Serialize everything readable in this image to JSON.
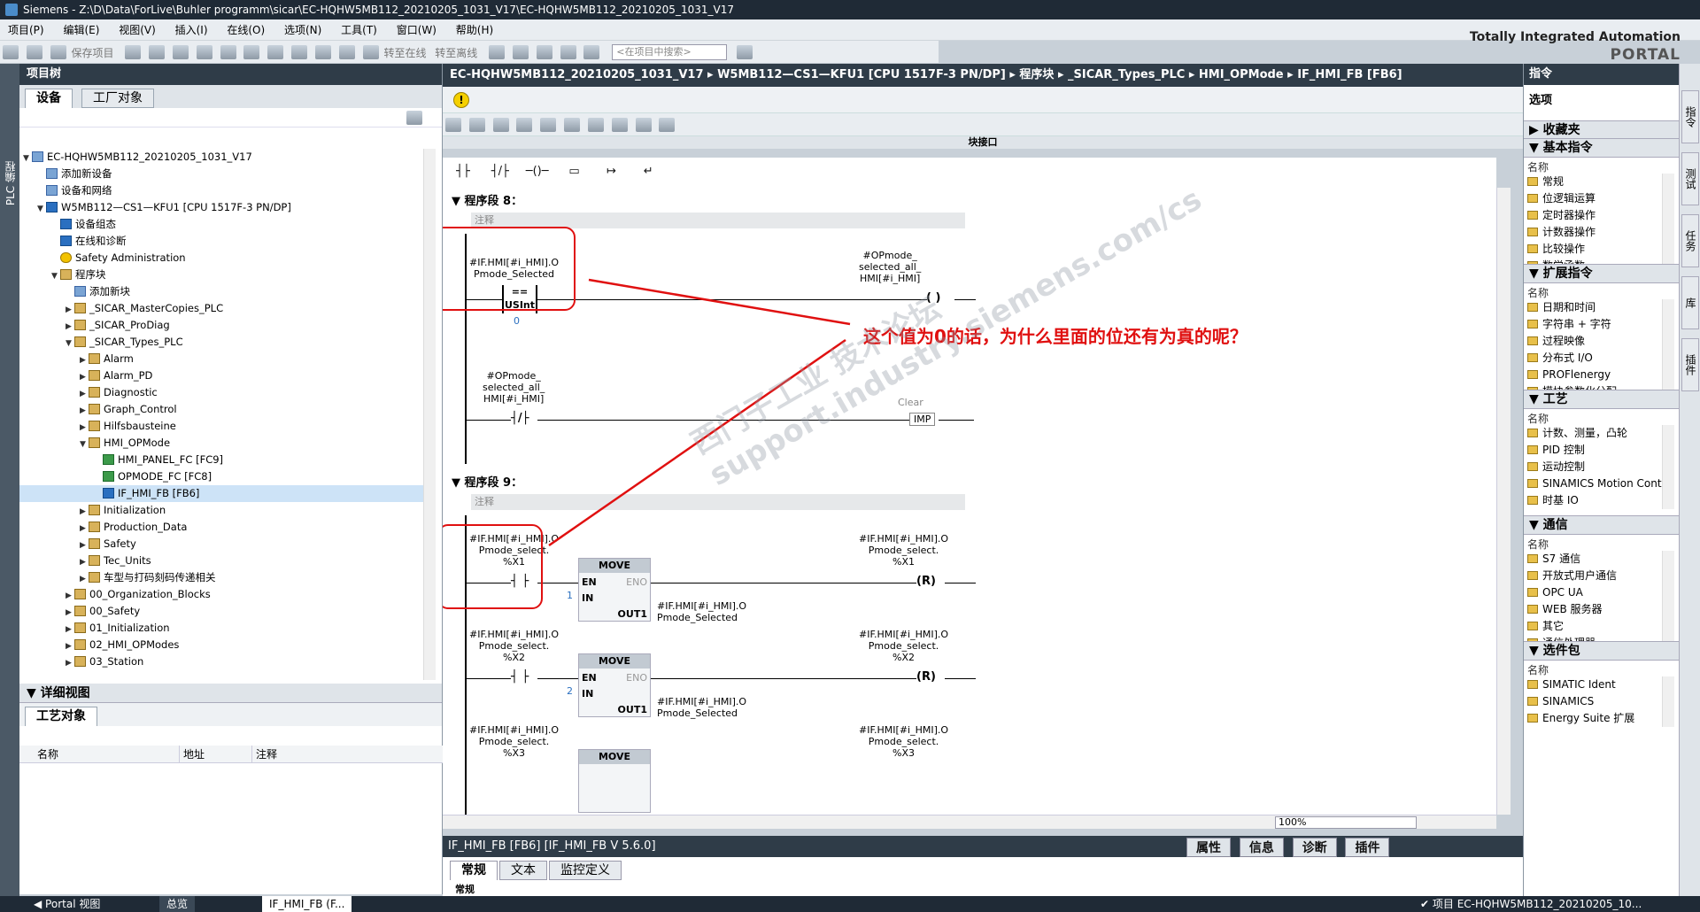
{
  "window": {
    "title": "Siemens  -  Z:\\D\\Data\\ForLive\\Buhler programm\\sicar\\EC-HQHW5MB112_20210205_1031_V17\\EC-HQHW5MB112_20210205_1031_V17"
  },
  "menu": [
    "项目(P)",
    "编辑(E)",
    "视图(V)",
    "插入(I)",
    "在线(O)",
    "选项(N)",
    "工具(T)",
    "窗口(W)",
    "帮助(H)"
  ],
  "portal": {
    "line1": "Totally Integrated Automation",
    "line2": "PORTAL"
  },
  "toolbar": {
    "save_project": "保存项目",
    "go_online": "转至在线",
    "go_offline": "转至离线",
    "search_placeholder": "<在项目中搜索>"
  },
  "left_strip": {
    "label": "PLC 编程"
  },
  "project_tree": {
    "title": "项目树",
    "tabs": [
      "设备",
      "工厂对象"
    ],
    "nodes": [
      {
        "label": "EC-HQHW5MB112_20210205_1031_V17",
        "depth": 0,
        "toggle": "▼",
        "icon": "p"
      },
      {
        "label": "添加新设备",
        "depth": 1,
        "toggle": "",
        "icon": "p"
      },
      {
        "label": "设备和网络",
        "depth": 1,
        "toggle": "",
        "icon": "p"
      },
      {
        "label": "W5MB112—CS1—KFU1 [CPU 1517F-3 PN/DP]",
        "depth": 1,
        "toggle": "▼",
        "icon": "b"
      },
      {
        "label": "设备组态",
        "depth": 2,
        "toggle": "",
        "icon": "b"
      },
      {
        "label": "在线和诊断",
        "depth": 2,
        "toggle": "",
        "icon": "b"
      },
      {
        "label": "Safety Administration",
        "depth": 2,
        "toggle": "",
        "icon": "y"
      },
      {
        "label": "程序块",
        "depth": 2,
        "toggle": "▼",
        "icon": ""
      },
      {
        "label": "添加新块",
        "depth": 3,
        "toggle": "",
        "icon": "p"
      },
      {
        "label": "_SICAR_MasterCopies_PLC",
        "depth": 3,
        "toggle": "▶",
        "icon": ""
      },
      {
        "label": "_SICAR_ProDiag",
        "depth": 3,
        "toggle": "▶",
        "icon": ""
      },
      {
        "label": "_SICAR_Types_PLC",
        "depth": 3,
        "toggle": "▼",
        "icon": ""
      },
      {
        "label": "Alarm",
        "depth": 4,
        "toggle": "▶",
        "icon": ""
      },
      {
        "label": "Alarm_PD",
        "depth": 4,
        "toggle": "▶",
        "icon": ""
      },
      {
        "label": "Diagnostic",
        "depth": 4,
        "toggle": "▶",
        "icon": ""
      },
      {
        "label": "Graph_Control",
        "depth": 4,
        "toggle": "▶",
        "icon": ""
      },
      {
        "label": "Hilfsbausteine",
        "depth": 4,
        "toggle": "▶",
        "icon": ""
      },
      {
        "label": "HMI_OPMode",
        "depth": 4,
        "toggle": "▼",
        "icon": ""
      },
      {
        "label": "HMI_PANEL_FC [FC9]",
        "depth": 5,
        "toggle": "",
        "icon": "g"
      },
      {
        "label": "OPMODE_FC [FC8]",
        "depth": 5,
        "toggle": "",
        "icon": "g"
      },
      {
        "label": "IF_HMI_FB [FB6]",
        "depth": 5,
        "toggle": "",
        "icon": "b",
        "selected": true
      },
      {
        "label": "Initialization",
        "depth": 4,
        "toggle": "▶",
        "icon": ""
      },
      {
        "label": "Production_Data",
        "depth": 4,
        "toggle": "▶",
        "icon": ""
      },
      {
        "label": "Safety",
        "depth": 4,
        "toggle": "▶",
        "icon": ""
      },
      {
        "label": "Tec_Units",
        "depth": 4,
        "toggle": "▶",
        "icon": ""
      },
      {
        "label": "车型与打码刻码传递相关",
        "depth": 4,
        "toggle": "▶",
        "icon": ""
      },
      {
        "label": "00_Organization_Blocks",
        "depth": 3,
        "toggle": "▶",
        "icon": ""
      },
      {
        "label": "00_Safety",
        "depth": 3,
        "toggle": "▶",
        "icon": ""
      },
      {
        "label": "01_Initialization",
        "depth": 3,
        "toggle": "▶",
        "icon": ""
      },
      {
        "label": "02_HMI_OPModes",
        "depth": 3,
        "toggle": "▶",
        "icon": ""
      },
      {
        "label": "03_Station",
        "depth": 3,
        "toggle": "▶",
        "icon": ""
      }
    ]
  },
  "detail_view": {
    "title": "详细视图",
    "tab": "工艺对象",
    "columns": [
      "名称",
      "地址",
      "注释"
    ]
  },
  "editor": {
    "breadcrumb": "EC-HQHW5MB112_20210205_1031_V17  ▸  W5MB112—CS1—KFU1 [CPU 1517F-3 PN/DP]  ▸  程序块  ▸  _SICAR_Types_PLC  ▸  HMI_OPMode  ▸  IF_HMI_FB [FB6]",
    "interface_label": "块接口",
    "network8": {
      "title": "程序段 8：",
      "comment": "注释",
      "cmp_operand": "#IF.HMI[#i_HMI].O\nPmode_Selected",
      "cmp_op": "==",
      "cmp_type": "USInt",
      "cmp_value": "0",
      "coil1_operand": "#OPmode_\nselected_all_\nHMI[#i_HMI]",
      "contact2_operand": "#OPmode_\nselected_all_\nHMI[#i_HMI]",
      "clear_label": "Clear",
      "clear_box": "IMP"
    },
    "network9": {
      "title": "程序段 9：",
      "comment": "注释",
      "rows": [
        {
          "contact": "#IF.HMI[#i_HMI].O\nPmode_select.\n%X1",
          "coil": "#IF.HMI[#i_HMI].O\nPmode_select.\n%X1",
          "in": "1",
          "out": "#IF.HMI[#i_HMI].O\nPmode_Selected"
        },
        {
          "contact": "#IF.HMI[#i_HMI].O\nPmode_select.\n%X2",
          "coil": "#IF.HMI[#i_HMI].O\nPmode_select.\n%X2",
          "in": "2",
          "out": "#IF.HMI[#i_HMI].O\nPmode_Selected"
        },
        {
          "contact": "#IF.HMI[#i_HMI].O\nPmode_select.\n%X3",
          "coil": "#IF.HMI[#i_HMI].O\nPmode_select.\n%X3",
          "in": "",
          "out": ""
        }
      ],
      "move_label": "MOVE",
      "en": "EN",
      "eno": "ENO",
      "in_pin": "IN",
      "out_pin": "OUT1",
      "coil_symbol": "R"
    },
    "annotation": "这个值为0的话，为什么里面的位还有为真的呢？",
    "watermark": "西门子工业 技术论坛\nsupport.industry.siemens.com/cs",
    "zoom": "100%"
  },
  "properties": {
    "header": "IF_HMI_FB [FB6] [IF_HMI_FB V 5.6.0]",
    "tabs": [
      "属性",
      "信息",
      "诊断",
      "插件"
    ],
    "subtabs": [
      "常规",
      "文本",
      "监控定义"
    ],
    "first_row": "常规"
  },
  "instructions": {
    "title": "指令",
    "options": "选项",
    "sections": [
      {
        "title": "收藏夹",
        "items": []
      },
      {
        "title": "基本指令",
        "sub": "名称",
        "items": [
          "常规",
          "位逻辑运算",
          "定时器操作",
          "计数器操作",
          "比较操作",
          "数学函数"
        ]
      },
      {
        "title": "扩展指令",
        "sub": "名称",
        "items": [
          "日期和时间",
          "字符串 + 字符",
          "过程映像",
          "分布式 I/O",
          "PROFlenergy",
          "模块参数化分配"
        ]
      },
      {
        "title": "工艺",
        "sub": "名称",
        "items": [
          "计数、测量，凸轮",
          "PID 控制",
          "运动控制",
          "SINAMICS Motion Contr...",
          "时基 IO"
        ]
      },
      {
        "title": "通信",
        "sub": "名称",
        "items": [
          "S7 通信",
          "开放式用户通信",
          "OPC UA",
          "WEB 服务器",
          "其它",
          "通信处理器"
        ]
      },
      {
        "title": "选件包",
        "sub": "名称",
        "items": [
          "SIMATIC Ident",
          "SINAMICS",
          "Energy Suite 扩展"
        ]
      }
    ]
  },
  "right_vtabs": [
    "指令",
    "测试",
    "任务",
    "库",
    "插件"
  ],
  "statusbar": {
    "portal_view": "Portal 视图",
    "overview": "总览",
    "editor_tab": "IF_HMI_FB (F...",
    "project_status": "项目 EC-HQHW5MB112_20210205_10..."
  }
}
